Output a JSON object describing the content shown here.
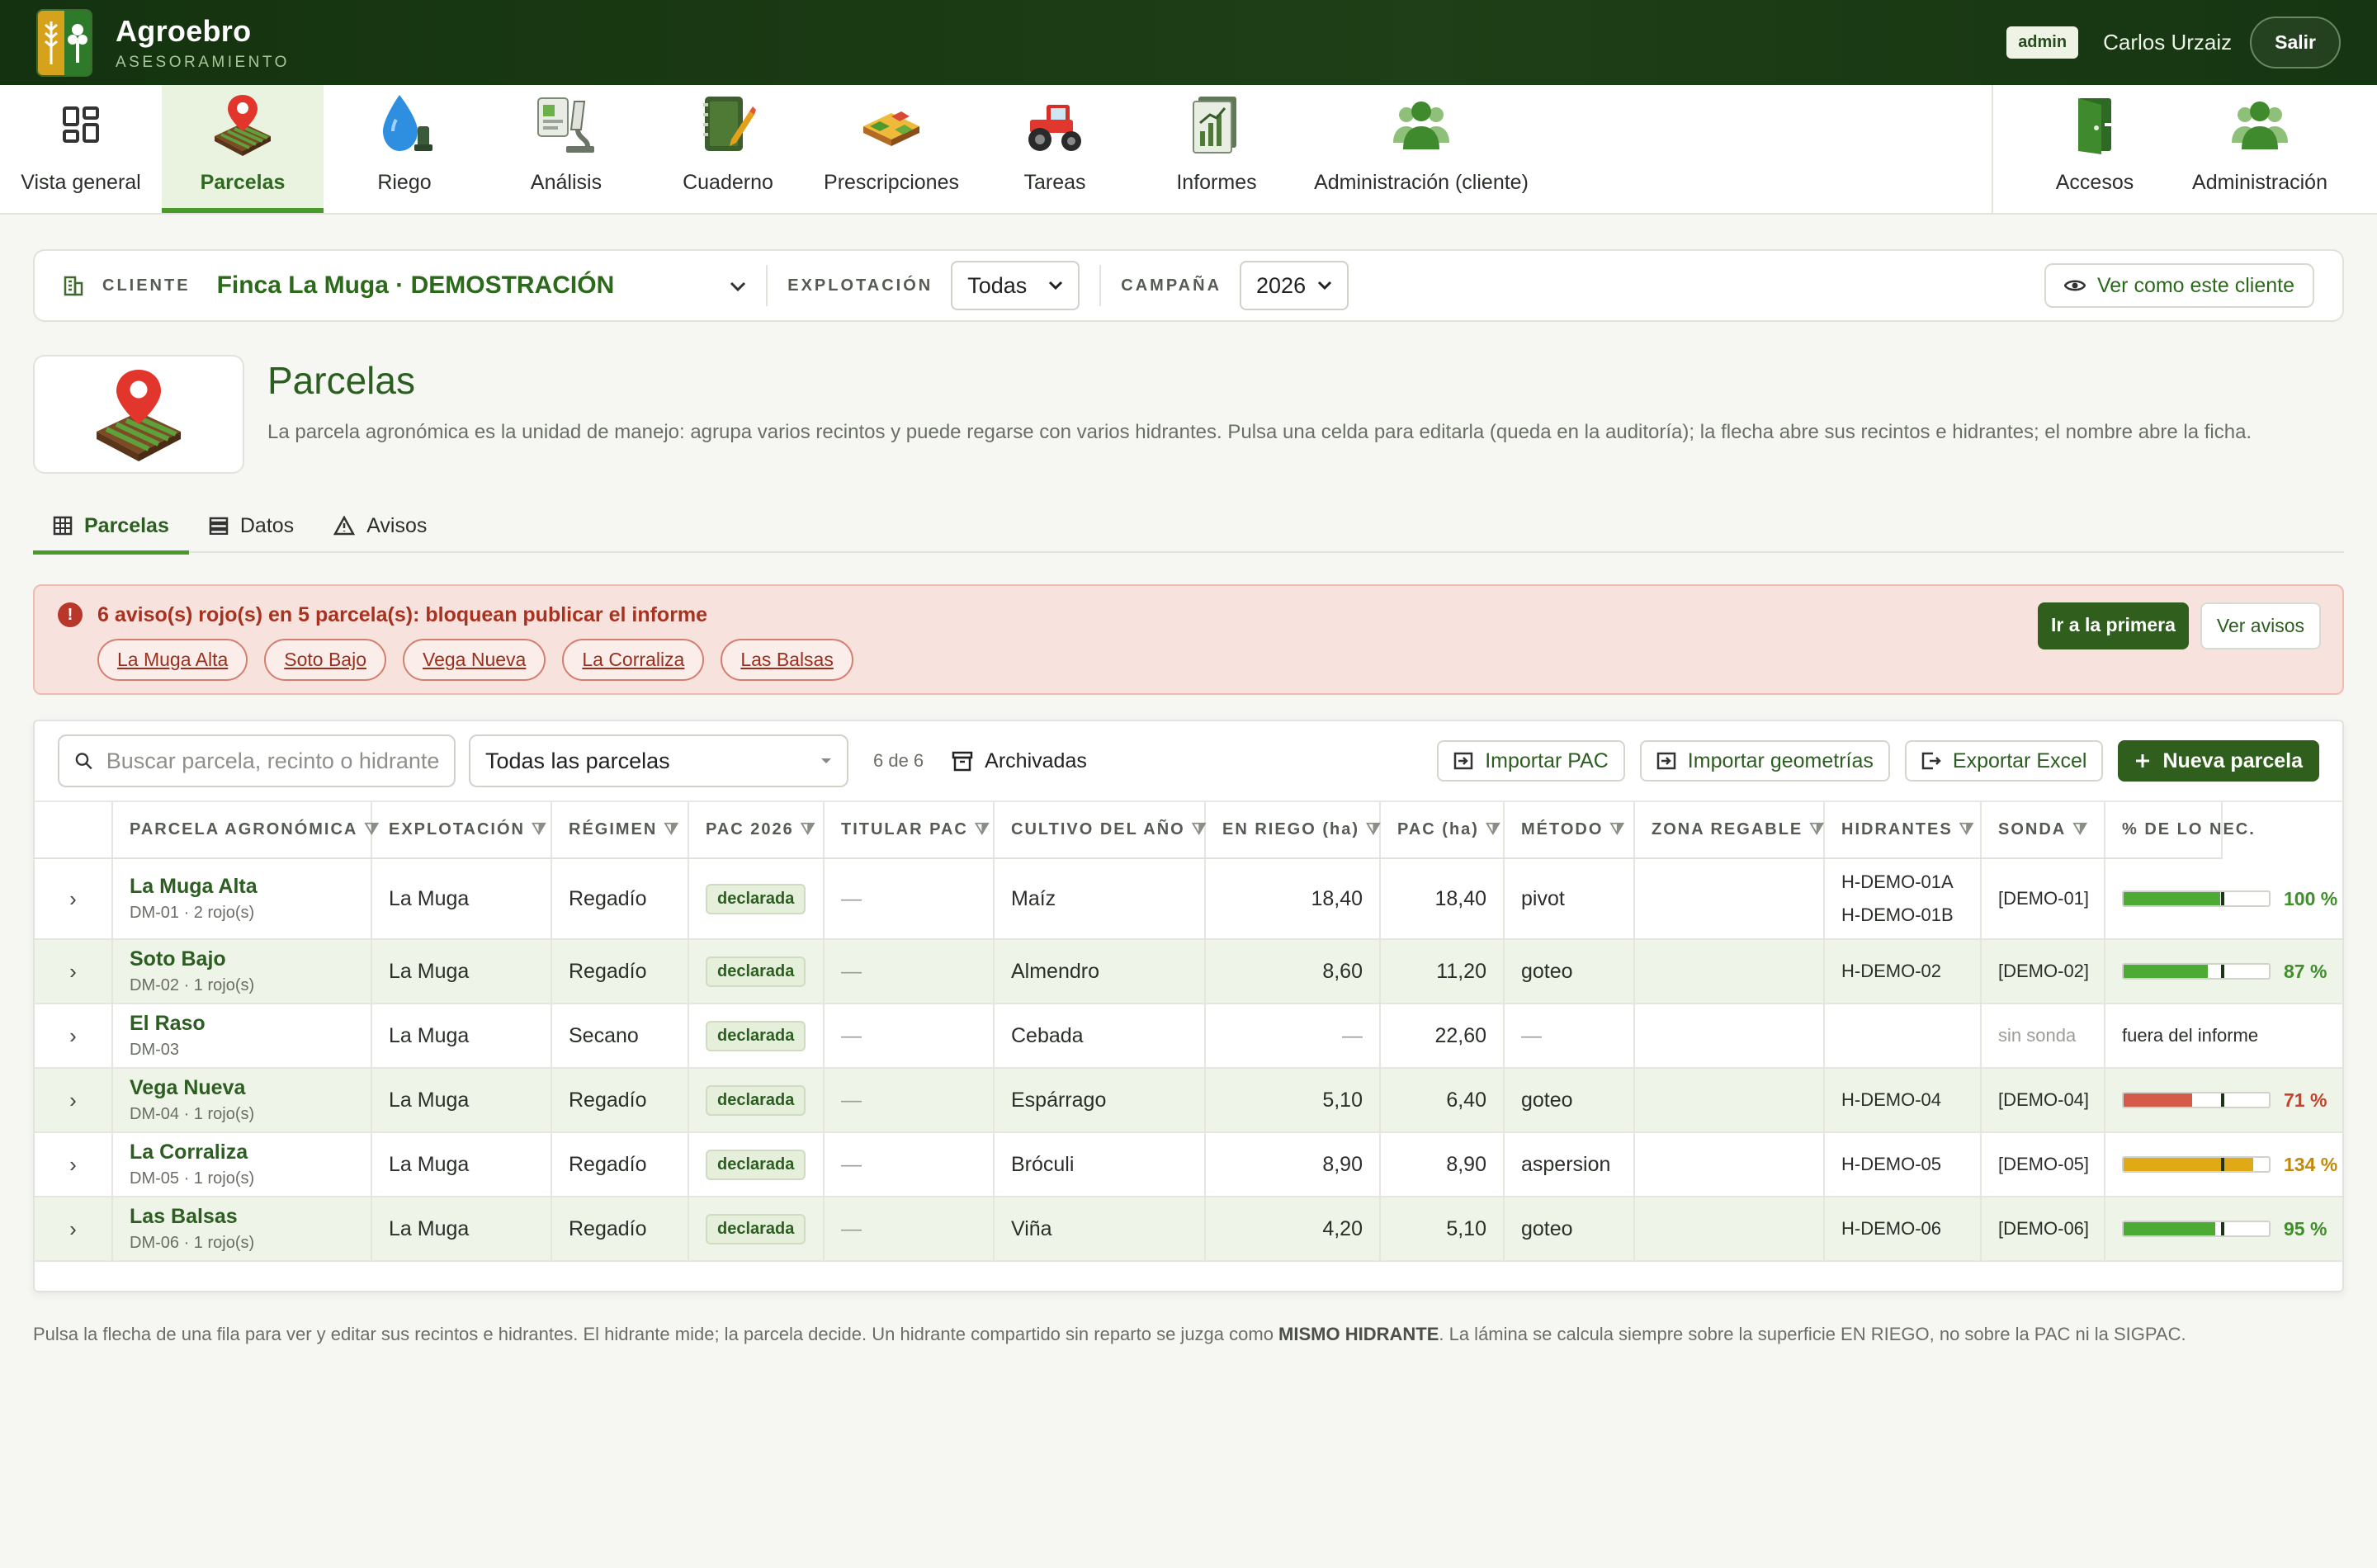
{
  "app": {
    "name": "Agroebro",
    "subtitle": "ASESORAMIENTO",
    "role": "admin",
    "user": "Carlos Urzaiz",
    "logout": "Salir"
  },
  "modules": [
    {
      "label": "Vista general",
      "icon": "dashboard-icon"
    },
    {
      "label": "Parcelas",
      "icon": "parcel-map-pin-icon"
    },
    {
      "label": "Riego",
      "icon": "water-drop-icon"
    },
    {
      "label": "Análisis",
      "icon": "microscope-icon"
    },
    {
      "label": "Cuaderno",
      "icon": "notebook-icon"
    },
    {
      "label": "Prescripciones",
      "icon": "field-layers-icon"
    },
    {
      "label": "Tareas",
      "icon": "tractor-icon"
    },
    {
      "label": "Informes",
      "icon": "report-chart-icon"
    },
    {
      "label": "Administración (cliente)",
      "icon": "users-icon"
    },
    {
      "label": "Accesos",
      "icon": "door-icon"
    },
    {
      "label": "Administración",
      "icon": "users-icon"
    }
  ],
  "clientbar": {
    "client_label": "CLIENTE",
    "client": "Finca La Muga · DEMOSTRACIÓN",
    "exp_label": "EXPLOTACIÓN",
    "exp_value": "Todas",
    "camp_label": "CAMPAÑA",
    "camp_value": "2026",
    "view_as": "Ver como este cliente"
  },
  "page": {
    "title": "Parcelas",
    "description": "La parcela agronómica es la unidad de manejo: agrupa varios recintos y puede regarse con varios hidrantes. Pulsa una celda para editarla (queda en la auditoría); la flecha abre sus recintos e hidrantes; el nombre abre la ficha."
  },
  "tabs": [
    {
      "label": "Parcelas"
    },
    {
      "label": "Datos"
    },
    {
      "label": "Avisos"
    }
  ],
  "alert": {
    "title": "6 aviso(s) rojo(s) en 5 parcela(s): bloquean publicar el informe",
    "chips": [
      "La Muga Alta",
      "Soto Bajo",
      "Vega Nueva",
      "La Corraliza",
      "Las Balsas"
    ],
    "primary": "Ir a la primera",
    "secondary": "Ver avisos"
  },
  "toolbar": {
    "search_placeholder": "Buscar parcela, recinto o hidrante...",
    "filter": "Todas las parcelas",
    "count": "6 de 6",
    "archived": "Archivadas",
    "import_pac": "Importar PAC",
    "import_geo": "Importar geometrías",
    "export": "Exportar Excel",
    "new": "Nueva parcela"
  },
  "columns": [
    "PARCELA AGRONÓMICA",
    "EXPLOTACIÓN",
    "RÉGIMEN",
    "PAC 2026",
    "TITULAR PAC",
    "CULTIVO DEL AÑO",
    "EN RIEGO (ha)",
    "PAC (ha)",
    "MÉTODO",
    "ZONA REGABLE",
    "HIDRANTES",
    "SONDA",
    "% DE LO NEC."
  ],
  "rows": [
    {
      "name": "La Muga Alta",
      "sub": "DM-01 · 2 rojo(s)",
      "exp": "La Muga",
      "regimen": "Regadío",
      "pac": "declarada",
      "titular": "—",
      "cultivo": "Maíz",
      "riego": "18,40",
      "pac_ha": "18,40",
      "metodo": "pivot",
      "zona": "",
      "hidrantes": [
        "H-DEMO-01A",
        "H-DEMO-01B"
      ],
      "sonda": "[DEMO-01]",
      "pct": 100,
      "pct_label": "100 %",
      "color": "#4caa35"
    },
    {
      "name": "Soto Bajo",
      "sub": "DM-02 · 1 rojo(s)",
      "exp": "La Muga",
      "regimen": "Regadío",
      "pac": "declarada",
      "titular": "—",
      "cultivo": "Almendro",
      "riego": "8,60",
      "pac_ha": "11,20",
      "metodo": "goteo",
      "zona": "",
      "hidrantes": [
        "H-DEMO-02"
      ],
      "sonda": "[DEMO-02]",
      "pct": 87,
      "pct_label": "87 %",
      "color": "#4caa35"
    },
    {
      "name": "El Raso",
      "sub": "DM-03",
      "exp": "La Muga",
      "regimen": "Secano",
      "pac": "declarada",
      "titular": "—",
      "cultivo": "Cebada",
      "riego": "—",
      "pac_ha": "22,60",
      "metodo": "—",
      "zona": "",
      "hidrantes": [],
      "sonda": "sin sonda",
      "note": "fuera del informe"
    },
    {
      "name": "Vega Nueva",
      "sub": "DM-04 · 1 rojo(s)",
      "exp": "La Muga",
      "regimen": "Regadío",
      "pac": "declarada",
      "titular": "—",
      "cultivo": "Espárrago",
      "riego": "5,10",
      "pac_ha": "6,40",
      "metodo": "goteo",
      "zona": "",
      "hidrantes": [
        "H-DEMO-04"
      ],
      "sonda": "[DEMO-04]",
      "pct": 71,
      "pct_label": "71 %",
      "color": "#d65a4a"
    },
    {
      "name": "La Corraliza",
      "sub": "DM-05 · 1 rojo(s)",
      "exp": "La Muga",
      "regimen": "Regadío",
      "pac": "declarada",
      "titular": "—",
      "cultivo": "Bróculi",
      "riego": "8,90",
      "pac_ha": "8,90",
      "metodo": "aspersion",
      "zona": "",
      "hidrantes": [
        "H-DEMO-05"
      ],
      "sonda": "[DEMO-05]",
      "pct": 134,
      "pct_label": "134 %",
      "color": "#e0a916"
    },
    {
      "name": "Las Balsas",
      "sub": "DM-06 · 1 rojo(s)",
      "exp": "La Muga",
      "regimen": "Regadío",
      "pac": "declarada",
      "titular": "—",
      "cultivo": "Viña",
      "riego": "4,20",
      "pac_ha": "5,10",
      "metodo": "goteo",
      "zona": "",
      "hidrantes": [
        "H-DEMO-06"
      ],
      "sonda": "[DEMO-06]",
      "pct": 95,
      "pct_label": "95 %",
      "color": "#4caa35"
    }
  ],
  "footnote": {
    "pre": "Pulsa la flecha de una fila para ver y editar sus recintos e hidrantes. El hidrante mide; la parcela decide. Un hidrante compartido sin reparto se juzga como ",
    "bold": "MISMO HIDRANTE",
    "post": ". La lámina se calcula siempre sobre la superficie EN RIEGO, no sobre la PAC ni la SIGPAC."
  }
}
